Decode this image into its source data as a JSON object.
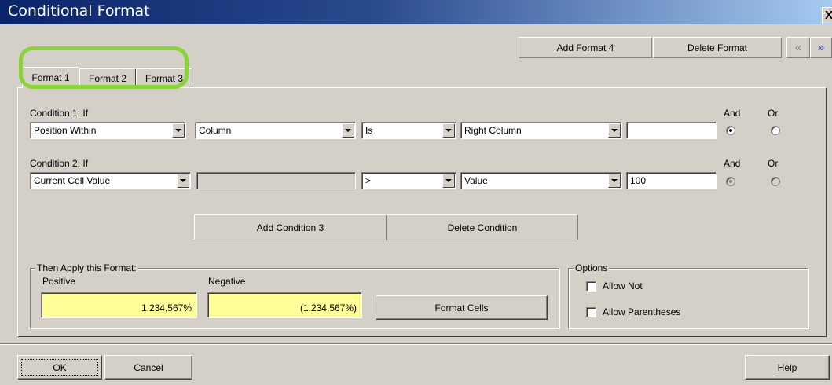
{
  "window": {
    "title": "Conditional Format",
    "close_label": "X"
  },
  "toolbar": {
    "add_format_label": "Add Format 4",
    "delete_format_label": "Delete Format",
    "prev_label": "«",
    "next_label": "»"
  },
  "tabs": [
    {
      "label": "Format 1",
      "active": true
    },
    {
      "label": "Format 2",
      "active": false
    },
    {
      "label": "Format 3",
      "active": false
    }
  ],
  "conditions": [
    {
      "label": "Condition 1: If",
      "field1": "Position Within",
      "field2": "Column",
      "operator": "Is",
      "field3": "Right Column",
      "value": "",
      "and_label": "And",
      "or_label": "Or",
      "selected": "and"
    },
    {
      "label": "Condition 2: If",
      "field1": "Current Cell Value",
      "field2": "",
      "operator": ">",
      "field3": "Value",
      "value": "100",
      "and_label": "And",
      "or_label": "Or",
      "selected": "and"
    }
  ],
  "condition_buttons": {
    "add_label": "Add Condition 3",
    "delete_label": "Delete Condition"
  },
  "apply_format": {
    "title": "Then Apply this Format:",
    "positive_label": "Positive",
    "positive_value": "1,234,567%",
    "negative_label": "Negative",
    "negative_value": "(1,234,567%)",
    "format_cells_label": "Format Cells",
    "sample_color": "#ffff99"
  },
  "options": {
    "title": "Options",
    "allow_not_label": "Allow Not",
    "allow_parentheses_label": "Allow Parentheses"
  },
  "footer": {
    "ok_label": "OK",
    "cancel_label": "Cancel",
    "help_label": "Help"
  },
  "colors": {
    "dialog_bg": "#d4d0c8",
    "titlebar_start": "#0a246a",
    "titlebar_end": "#a6caf0",
    "highlight": "#8ad43a"
  }
}
